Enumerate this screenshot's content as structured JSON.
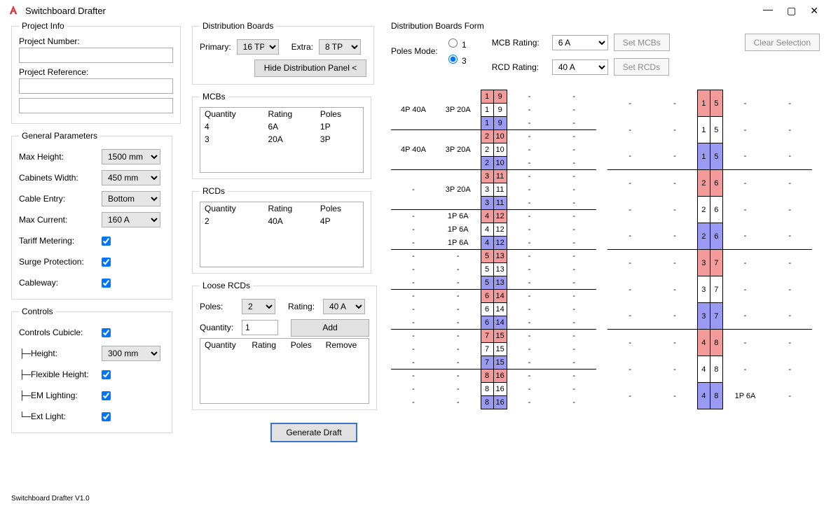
{
  "app": {
    "title": "Switchboard Drafter"
  },
  "footer": "Switchboard Drafter V1.0",
  "project_info": {
    "legend": "Project Info",
    "number_label": "Project Number:",
    "number_value": "",
    "ref_label": "Project Reference:",
    "ref1": "",
    "ref2": ""
  },
  "general": {
    "legend": "General Parameters",
    "max_height_label": "Max Height:",
    "max_height_value": "1500 mm",
    "cab_width_label": "Cabinets Width:",
    "cab_width_value": "450 mm",
    "cable_entry_label": "Cable Entry:",
    "cable_entry_value": "Bottom",
    "max_current_label": "Max Current:",
    "max_current_value": "160 A",
    "tariff_label": "Tariff Metering:",
    "surge_label": "Surge Protection:",
    "cableway_label": "Cableway:"
  },
  "controls": {
    "legend": "Controls",
    "cubicle_label": "Controls Cubicle:",
    "height_label": "├─Height:",
    "height_value": "300 mm",
    "flex_label": "├─Flexible Height:",
    "em_label": "├─EM Lighting:",
    "ext_label": "└─Ext Light:"
  },
  "dist_boards": {
    "legend": "Distribution Boards",
    "primary_label": "Primary:",
    "primary_value": "16 TP",
    "extra_label": "Extra:",
    "extra_value": "8 TP",
    "hide_panel_btn": "Hide Distribution Panel <"
  },
  "mcbs": {
    "legend": "MCBs",
    "headers": [
      "Quantity",
      "Rating",
      "Poles"
    ],
    "rows": [
      [
        "4",
        "6A",
        "1P"
      ],
      [
        "3",
        "20A",
        "3P"
      ]
    ]
  },
  "rcds": {
    "legend": "RCDs",
    "headers": [
      "Quantity",
      "Rating",
      "Poles"
    ],
    "rows": [
      [
        "2",
        "40A",
        "4P"
      ]
    ]
  },
  "loose_rcds": {
    "legend": "Loose RCDs",
    "poles_label": "Poles:",
    "poles_value": "2",
    "rating_label": "Rating:",
    "rating_value": "40 A",
    "qty_label": "Quantity:",
    "qty_value": "1",
    "add_btn": "Add",
    "headers": [
      "Quantity",
      "Rating",
      "Poles",
      "Remove"
    ]
  },
  "generate_btn": "Generate Draft",
  "db_form": {
    "legend": "Distribution Boards Form",
    "poles_mode_label": "Poles Mode:",
    "poles_radio_1": "1",
    "poles_radio_3": "3",
    "poles_selected": "3",
    "mcb_rating_label": "MCB Rating:",
    "mcb_rating_value": "6 A",
    "set_mcbs_btn": "Set MCBs",
    "rcd_rating_label": "RCD Rating:",
    "rcd_rating_value": "40 A",
    "set_rcds_btn": "Set RCDs",
    "clear_sel_btn": "Clear Selection"
  },
  "grid_left": [
    {
      "l1": "",
      "l2": "",
      "a": "1",
      "b": "9",
      "bgA": "red",
      "bgB": "red",
      "r1": "-",
      "r2": "-",
      "sep": false
    },
    {
      "l1": "4P 40A",
      "l2": "3P 20A",
      "a": "1",
      "b": "9",
      "bgA": "",
      "bgB": "",
      "r1": "-",
      "r2": "-",
      "sep": false
    },
    {
      "l1": "",
      "l2": "",
      "a": "1",
      "b": "9",
      "bgA": "blue",
      "bgB": "blue",
      "r1": "-",
      "r2": "-",
      "sep": true
    },
    {
      "l1": "",
      "l2": "",
      "a": "2",
      "b": "10",
      "bgA": "red",
      "bgB": "red",
      "r1": "-",
      "r2": "-",
      "sep": false
    },
    {
      "l1": "4P 40A",
      "l2": "3P 20A",
      "a": "2",
      "b": "10",
      "bgA": "",
      "bgB": "",
      "r1": "-",
      "r2": "-",
      "sep": false
    },
    {
      "l1": "",
      "l2": "",
      "a": "2",
      "b": "10",
      "bgA": "blue",
      "bgB": "blue",
      "r1": "-",
      "r2": "-",
      "sep": true
    },
    {
      "l1": "",
      "l2": "",
      "a": "3",
      "b": "11",
      "bgA": "red",
      "bgB": "red",
      "r1": "-",
      "r2": "-",
      "sep": false
    },
    {
      "l1": "-",
      "l2": "3P 20A",
      "a": "3",
      "b": "11",
      "bgA": "",
      "bgB": "",
      "r1": "-",
      "r2": "-",
      "sep": false
    },
    {
      "l1": "",
      "l2": "",
      "a": "3",
      "b": "11",
      "bgA": "blue",
      "bgB": "blue",
      "r1": "-",
      "r2": "-",
      "sep": true
    },
    {
      "l1": "-",
      "l2": "1P 6A",
      "a": "4",
      "b": "12",
      "bgA": "red",
      "bgB": "red",
      "r1": "-",
      "r2": "-",
      "sep": false
    },
    {
      "l1": "-",
      "l2": "1P 6A",
      "a": "4",
      "b": "12",
      "bgA": "",
      "bgB": "",
      "r1": "-",
      "r2": "-",
      "sep": false
    },
    {
      "l1": "-",
      "l2": "1P 6A",
      "a": "4",
      "b": "12",
      "bgA": "blue",
      "bgB": "blue",
      "r1": "-",
      "r2": "-",
      "sep": true
    },
    {
      "l1": "-",
      "l2": "-",
      "a": "5",
      "b": "13",
      "bgA": "red",
      "bgB": "red",
      "r1": "-",
      "r2": "-",
      "sep": false
    },
    {
      "l1": "-",
      "l2": "-",
      "a": "5",
      "b": "13",
      "bgA": "",
      "bgB": "",
      "r1": "-",
      "r2": "-",
      "sep": false
    },
    {
      "l1": "-",
      "l2": "-",
      "a": "5",
      "b": "13",
      "bgA": "blue",
      "bgB": "blue",
      "r1": "-",
      "r2": "-",
      "sep": true
    },
    {
      "l1": "-",
      "l2": "-",
      "a": "6",
      "b": "14",
      "bgA": "red",
      "bgB": "red",
      "r1": "-",
      "r2": "-",
      "sep": false
    },
    {
      "l1": "-",
      "l2": "-",
      "a": "6",
      "b": "14",
      "bgA": "",
      "bgB": "",
      "r1": "-",
      "r2": "-",
      "sep": false
    },
    {
      "l1": "-",
      "l2": "-",
      "a": "6",
      "b": "14",
      "bgA": "blue",
      "bgB": "blue",
      "r1": "-",
      "r2": "-",
      "sep": true
    },
    {
      "l1": "-",
      "l2": "-",
      "a": "7",
      "b": "15",
      "bgA": "red",
      "bgB": "red",
      "r1": "-",
      "r2": "-",
      "sep": false
    },
    {
      "l1": "-",
      "l2": "-",
      "a": "7",
      "b": "15",
      "bgA": "",
      "bgB": "",
      "r1": "-",
      "r2": "-",
      "sep": false
    },
    {
      "l1": "-",
      "l2": "-",
      "a": "7",
      "b": "15",
      "bgA": "blue",
      "bgB": "blue",
      "r1": "-",
      "r2": "-",
      "sep": true
    },
    {
      "l1": "-",
      "l2": "-",
      "a": "8",
      "b": "16",
      "bgA": "red",
      "bgB": "red",
      "r1": "-",
      "r2": "-",
      "sep": false
    },
    {
      "l1": "-",
      "l2": "-",
      "a": "8",
      "b": "16",
      "bgA": "",
      "bgB": "",
      "r1": "-",
      "r2": "-",
      "sep": false
    },
    {
      "l1": "-",
      "l2": "-",
      "a": "8",
      "b": "16",
      "bgA": "blue",
      "bgB": "blue",
      "r1": "-",
      "r2": "-",
      "sep": false
    }
  ],
  "grid_right": [
    {
      "l1": "-",
      "l2": "-",
      "a": "1",
      "b": "5",
      "bgA": "red",
      "bgB": "red",
      "r1": "-",
      "r2": "-",
      "sep": false
    },
    {
      "l1": "-",
      "l2": "-",
      "a": "1",
      "b": "5",
      "bgA": "",
      "bgB": "",
      "r1": "-",
      "r2": "-",
      "sep": false
    },
    {
      "l1": "-",
      "l2": "-",
      "a": "1",
      "b": "5",
      "bgA": "blue",
      "bgB": "blue",
      "r1": "-",
      "r2": "-",
      "sep": true
    },
    {
      "l1": "-",
      "l2": "-",
      "a": "2",
      "b": "6",
      "bgA": "red",
      "bgB": "red",
      "r1": "-",
      "r2": "-",
      "sep": false
    },
    {
      "l1": "-",
      "l2": "-",
      "a": "2",
      "b": "6",
      "bgA": "",
      "bgB": "",
      "r1": "-",
      "r2": "-",
      "sep": false
    },
    {
      "l1": "-",
      "l2": "-",
      "a": "2",
      "b": "6",
      "bgA": "blue",
      "bgB": "blue",
      "r1": "-",
      "r2": "-",
      "sep": true
    },
    {
      "l1": "-",
      "l2": "-",
      "a": "3",
      "b": "7",
      "bgA": "red",
      "bgB": "red",
      "r1": "-",
      "r2": "-",
      "sep": false
    },
    {
      "l1": "-",
      "l2": "-",
      "a": "3",
      "b": "7",
      "bgA": "",
      "bgB": "",
      "r1": "-",
      "r2": "-",
      "sep": false
    },
    {
      "l1": "-",
      "l2": "-",
      "a": "3",
      "b": "7",
      "bgA": "blue",
      "bgB": "blue",
      "r1": "-",
      "r2": "-",
      "sep": true
    },
    {
      "l1": "-",
      "l2": "-",
      "a": "4",
      "b": "8",
      "bgA": "red",
      "bgB": "red",
      "r1": "-",
      "r2": "-",
      "sep": false
    },
    {
      "l1": "-",
      "l2": "-",
      "a": "4",
      "b": "8",
      "bgA": "",
      "bgB": "",
      "r1": "-",
      "r2": "-",
      "sep": false
    },
    {
      "l1": "-",
      "l2": "-",
      "a": "4",
      "b": "8",
      "bgA": "blue",
      "bgB": "blue",
      "r1": "1P 6A",
      "r2": "-",
      "sep": false
    }
  ]
}
